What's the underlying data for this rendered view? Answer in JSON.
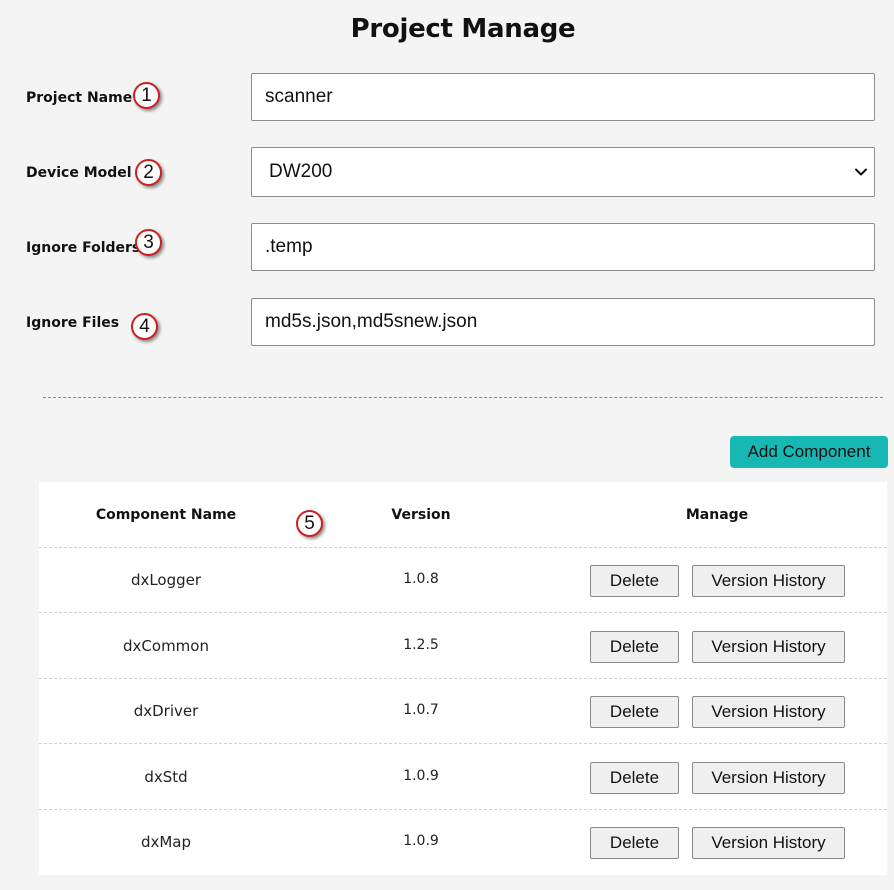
{
  "page": {
    "title": "Project Manage"
  },
  "form": {
    "project_name": {
      "label": "Project Name",
      "value": "scanner",
      "marker": "1"
    },
    "device_model": {
      "label": "Device Model",
      "value": "DW200",
      "marker": "2"
    },
    "ignore_folders": {
      "label": "Ignore Folders",
      "value": ".temp",
      "marker": "3"
    },
    "ignore_files": {
      "label": "Ignore Files",
      "value": "md5s.json,md5snew.json",
      "marker": "4"
    }
  },
  "components": {
    "add_label": "Add Component",
    "add_color": "#17b8b3",
    "marker": "5",
    "headers": {
      "name": "Component Name",
      "version": "Version",
      "manage": "Manage"
    },
    "delete_label": "Delete",
    "history_label": "Version History",
    "rows": [
      {
        "name": "dxLogger",
        "version": "1.0.8"
      },
      {
        "name": "dxCommon",
        "version": "1.2.5"
      },
      {
        "name": "dxDriver",
        "version": "1.0.7"
      },
      {
        "name": "dxStd",
        "version": "1.0.9"
      },
      {
        "name": "dxMap",
        "version": "1.0.9"
      }
    ]
  },
  "icons": {
    "select_arrow": "chevron-down-icon"
  }
}
